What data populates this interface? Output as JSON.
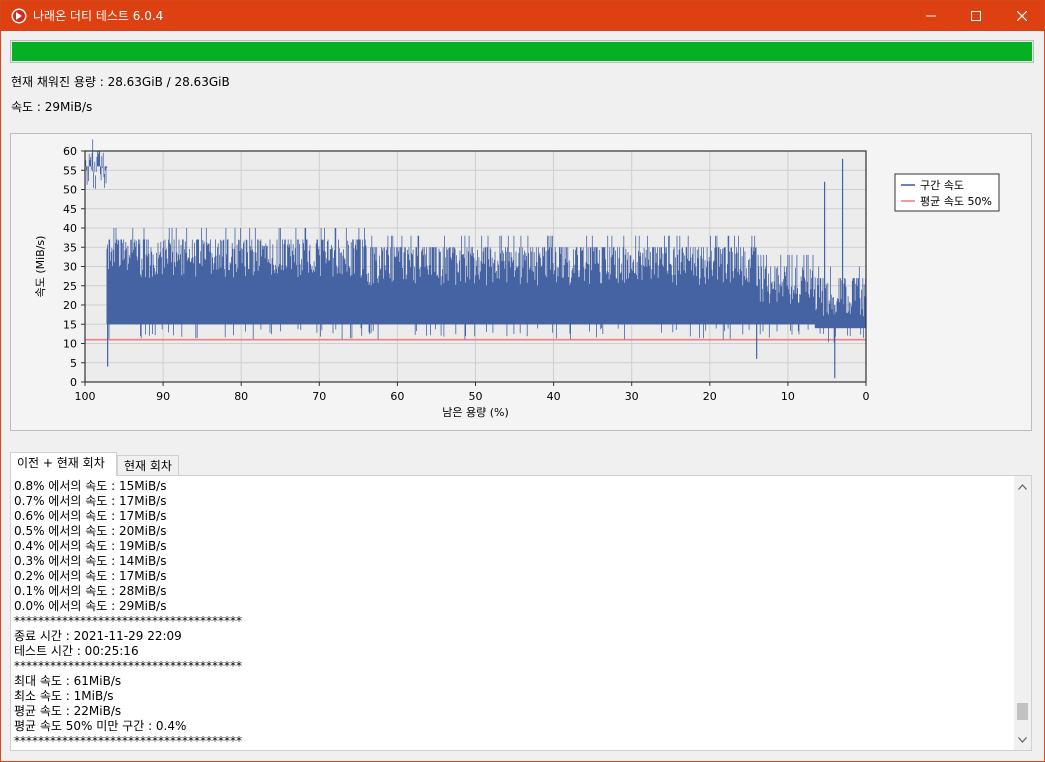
{
  "window": {
    "title": "나래온 더티 테스트 6.0.4"
  },
  "progress": {
    "fraction": 1.0,
    "color": "#06b025"
  },
  "info": {
    "filled": "현재 채워진 용량 : 28.63GiB / 28.63GiB",
    "speed": "속도 : 29MiB/s"
  },
  "chart_data": {
    "type": "line",
    "xlabel": "남은 용량 (%)",
    "ylabel": "속도 (MiB/s)",
    "xlim": [
      100,
      0
    ],
    "ylim": [
      0,
      60
    ],
    "x_ticks": [
      "100",
      "90",
      "80",
      "70",
      "60",
      "50",
      "40",
      "30",
      "20",
      "10",
      "0"
    ],
    "y_ticks": [
      "0",
      "5",
      "10",
      "15",
      "20",
      "25",
      "30",
      "35",
      "40",
      "45",
      "50",
      "55",
      "60"
    ],
    "grid": true,
    "legend_position": "right",
    "series": [
      {
        "name": "구간 속도",
        "color": "#4563a3",
        "segments": [
          {
            "x_from": 100,
            "x_to": 97.2,
            "low": 55,
            "high": 60
          },
          {
            "x_from": 97.2,
            "x_to": 64.0,
            "low": 14,
            "high": 37
          },
          {
            "x_from": 64.0,
            "x_to": 14.0,
            "low": 14,
            "high": 35
          },
          {
            "x_from": 14.0,
            "x_to": 11.0,
            "low": 14,
            "high": 30
          },
          {
            "x_from": 11.0,
            "x_to": 6.5,
            "low": 14,
            "high": 30
          },
          {
            "x_from": 6.5,
            "x_to": 0,
            "low": 13,
            "high": 27
          }
        ],
        "spikes": [
          {
            "x": 97.1,
            "y": 4
          },
          {
            "x": 5.3,
            "y": 52
          },
          {
            "x": 3.0,
            "y": 58
          },
          {
            "x": 4.0,
            "y": 1
          },
          {
            "x": 14.0,
            "y": 6
          }
        ]
      },
      {
        "name": "평균 속도 50%",
        "color": "#f08080",
        "value": 11
      }
    ]
  },
  "tabs": [
    {
      "label": "이전 + 현재 회차"
    },
    {
      "label": "현재 회차"
    }
  ],
  "log": [
    "0.8% 에서의 속도 : 15MiB/s",
    "0.7% 에서의 속도 : 17MiB/s",
    "0.6% 에서의 속도 : 17MiB/s",
    "0.5% 에서의 속도 : 20MiB/s",
    "0.4% 에서의 속도 : 19MiB/s",
    "0.3% 에서의 속도 : 14MiB/s",
    "0.2% 에서의 속도 : 17MiB/s",
    "0.1% 에서의 속도 : 28MiB/s",
    "0.0% 에서의 속도 : 29MiB/s",
    "**************************************",
    "종료 시간 : 2021-11-29 22:09",
    "테스트 시간 : 00:25:16",
    "**************************************",
    "최대 속도 : 61MiB/s",
    "최소 속도 : 1MiB/s",
    "평균 속도 : 22MiB/s",
    "평균 속도 50% 미만 구간 : 0.4%",
    "**************************************"
  ],
  "scroll": {
    "position": 0.96
  }
}
